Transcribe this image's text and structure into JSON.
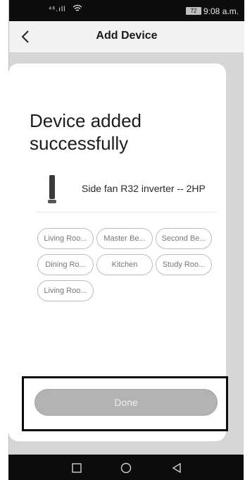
{
  "status_bar": {
    "signal": "⁴⁶.ıll",
    "battery": "72",
    "time": "9:08 a.m."
  },
  "header": {
    "title": "Add Device"
  },
  "main": {
    "headline": "Device added successfully",
    "device_name": "Side fan R32 inverter -- 2HP",
    "rooms": [
      "Living Roo...",
      "Master Be...",
      "Second Be...",
      "Dining Ro...",
      "Kitchen",
      "Study Roo...",
      "Living Roo..."
    ],
    "done_label": "Done"
  },
  "icons": {
    "back": "chevron-left-icon",
    "device": "side-fan-device-icon",
    "nav_recents": "square-icon",
    "nav_home": "circle-icon",
    "nav_back": "triangle-back-icon"
  },
  "colors": {
    "done_button": "#b3b3b3",
    "background": "#d6d6d6",
    "card": "#ffffff"
  }
}
